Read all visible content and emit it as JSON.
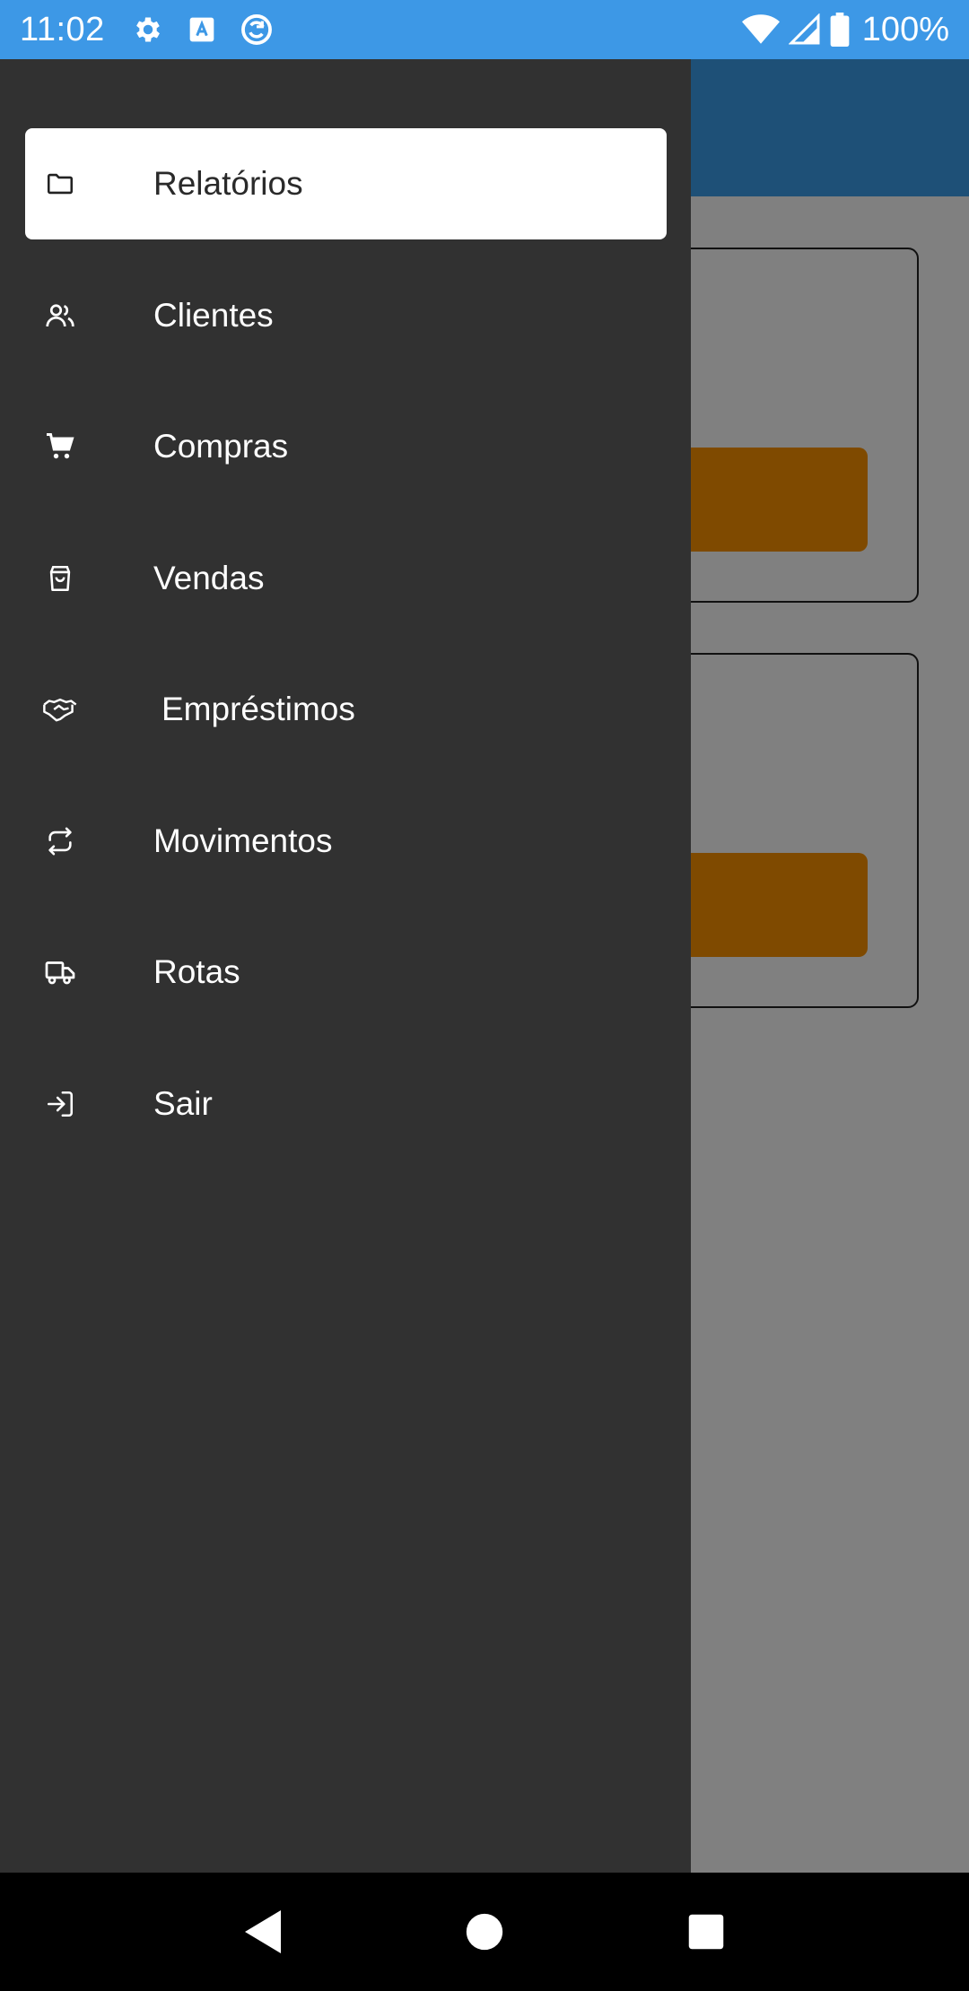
{
  "status_bar": {
    "time": "11:02",
    "battery": "100%",
    "icons": [
      "gear-icon",
      "a-box-icon",
      "sync-circle-icon",
      "wifi-icon",
      "signal-icon",
      "battery-icon"
    ]
  },
  "drawer": {
    "items": [
      {
        "label": "Relatórios",
        "icon": "folder-icon",
        "active": true
      },
      {
        "label": "Clientes",
        "icon": "users-icon",
        "active": false
      },
      {
        "label": "Compras",
        "icon": "cart-icon",
        "active": false
      },
      {
        "label": "Vendas",
        "icon": "bag-icon",
        "active": false
      },
      {
        "label": "Empréstimos",
        "icon": "handshake-icon",
        "active": false
      },
      {
        "label": "Movimentos",
        "icon": "repeat-icon",
        "active": false
      },
      {
        "label": "Rotas",
        "icon": "truck-icon",
        "active": false
      },
      {
        "label": "Sair",
        "icon": "login-icon",
        "active": false
      }
    ]
  },
  "colors": {
    "status_bar": "#3d98e6",
    "app_header": "#1e5077",
    "drawer_bg": "#313131",
    "scrim": "#808080",
    "card_button": "#7f4a00"
  },
  "nav_bar": {
    "buttons": [
      "back-icon",
      "home-icon",
      "recents-icon"
    ]
  }
}
